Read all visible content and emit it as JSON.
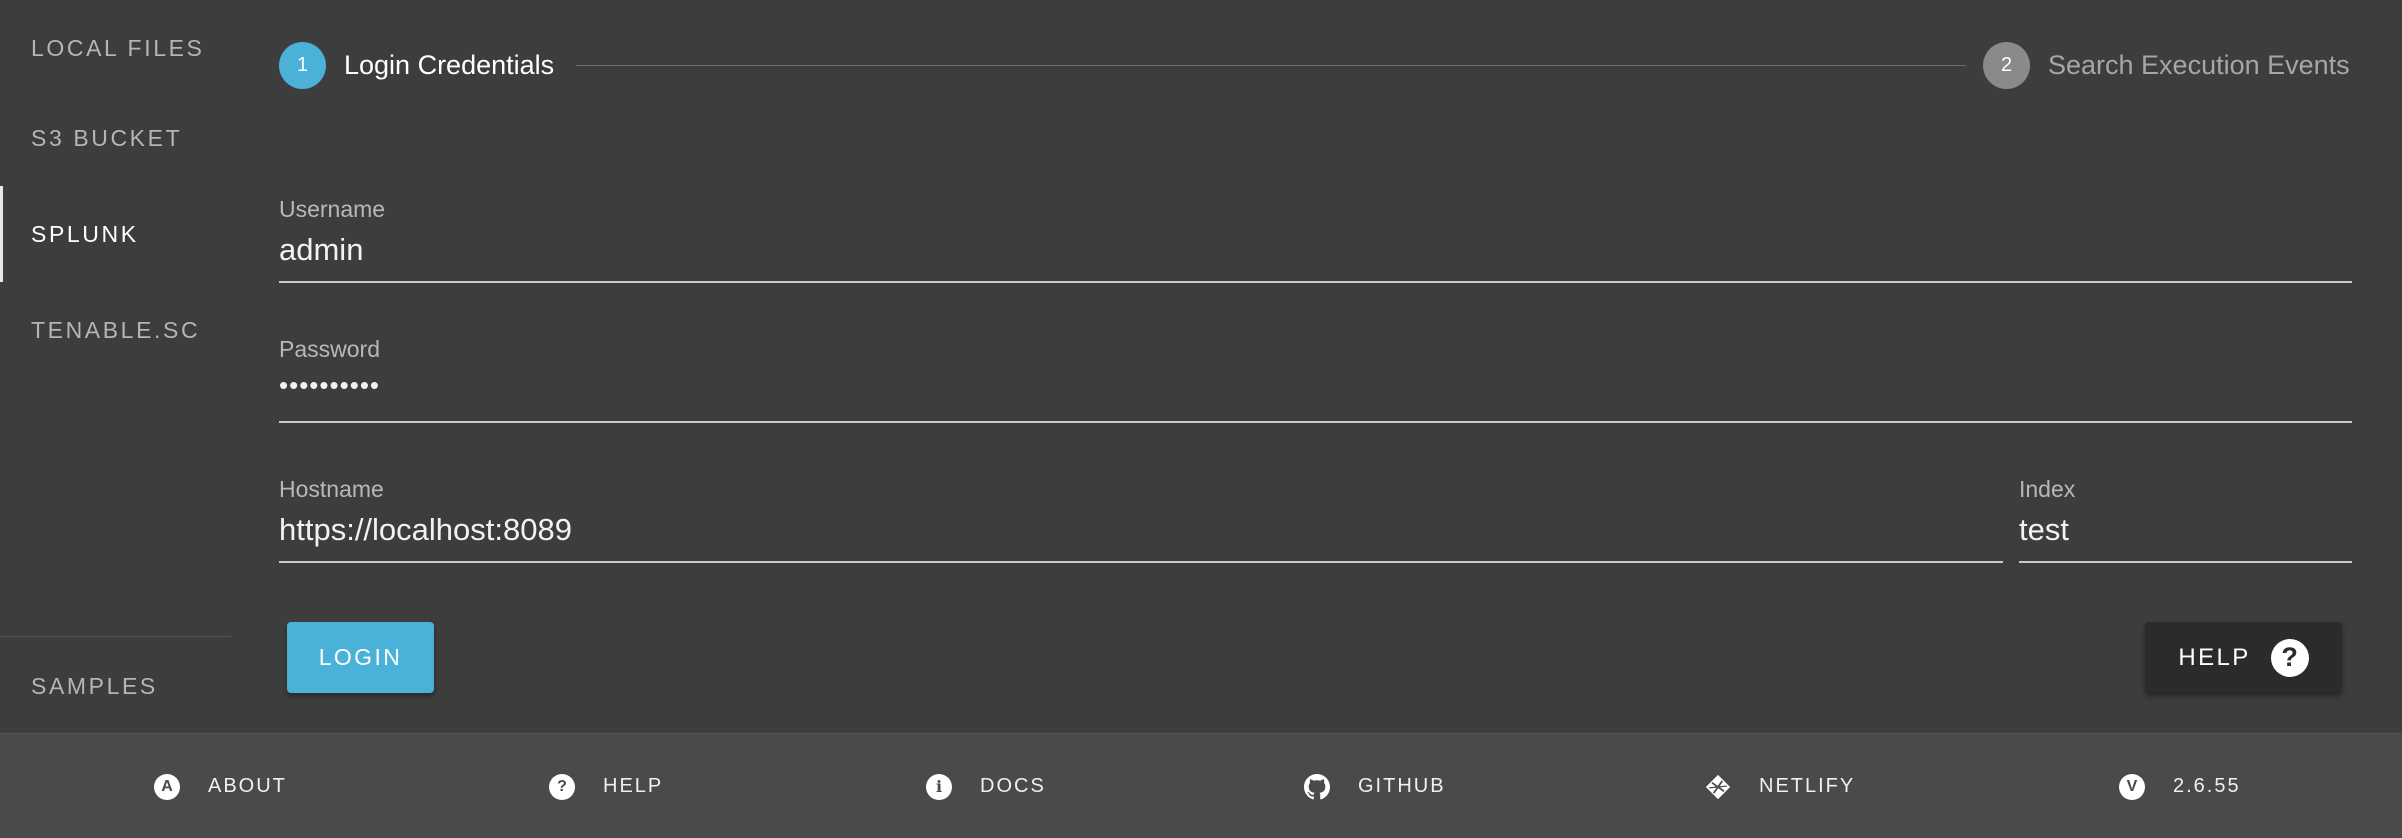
{
  "sidebar": {
    "items": [
      {
        "label": "LOCAL FILES"
      },
      {
        "label": "S3 BUCKET"
      },
      {
        "label": "SPLUNK"
      },
      {
        "label": "TENABLE.SC"
      }
    ],
    "bottom_item": {
      "label": "SAMPLES"
    }
  },
  "stepper": {
    "steps": [
      {
        "number": "1",
        "label": "Login Credentials"
      },
      {
        "number": "2",
        "label": "Search Execution Events"
      }
    ]
  },
  "form": {
    "username": {
      "label": "Username",
      "value": "admin"
    },
    "password": {
      "label": "Password",
      "value": "••••••••••"
    },
    "hostname": {
      "label": "Hostname",
      "value": "https://localhost:8089"
    },
    "index": {
      "label": "Index",
      "value": "test"
    }
  },
  "actions": {
    "login_label": "LOGIN",
    "help_label": "HELP",
    "help_glyph": "?"
  },
  "footer": {
    "items": [
      {
        "label": "ABOUT",
        "icon": "about-icon",
        "glyph": "A"
      },
      {
        "label": "HELP",
        "icon": "help-icon",
        "glyph": "?"
      },
      {
        "label": "DOCS",
        "icon": "info-icon",
        "glyph": "i"
      },
      {
        "label": "GITHUB",
        "icon": "github-icon",
        "glyph": ""
      },
      {
        "label": "NETLIFY",
        "icon": "netlify-icon",
        "glyph": ""
      },
      {
        "label": "2.6.55",
        "icon": "version-icon",
        "glyph": "V"
      }
    ]
  }
}
